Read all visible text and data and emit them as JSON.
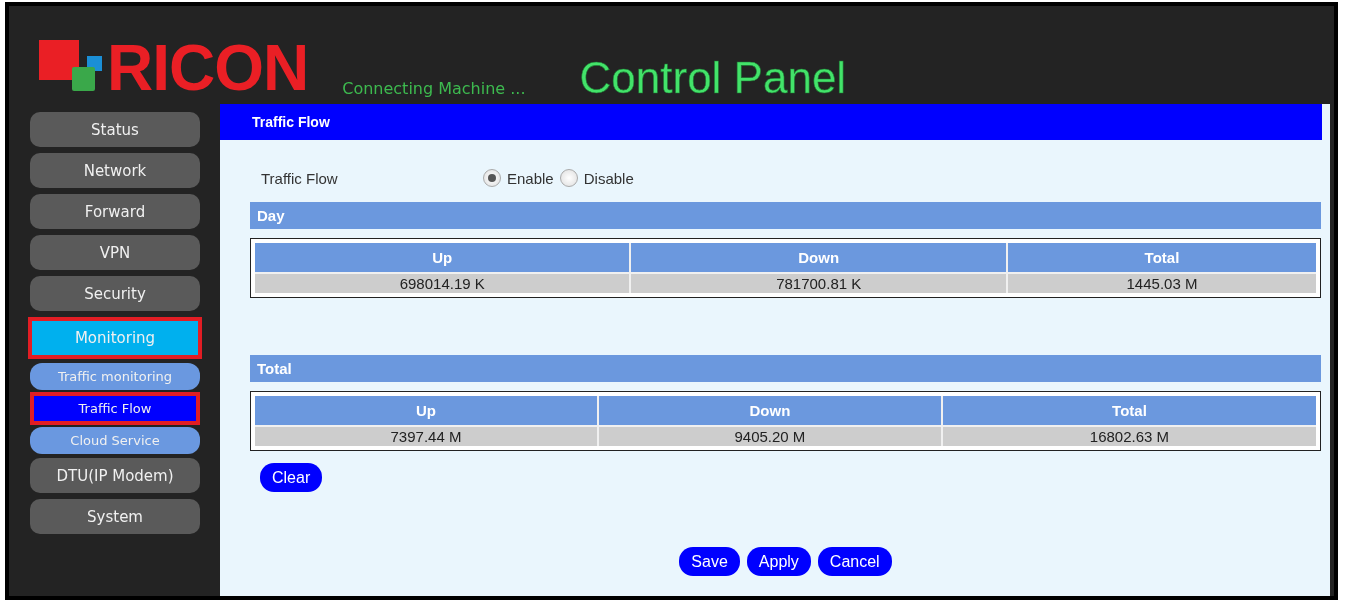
{
  "header": {
    "brand": "RICON",
    "tagline": "Connecting Machine ...",
    "title": "Control Panel"
  },
  "sidebar": {
    "items": [
      {
        "label": "Status",
        "kind": "main",
        "selected": false,
        "highlighted": false
      },
      {
        "label": "Network",
        "kind": "main",
        "selected": false,
        "highlighted": false
      },
      {
        "label": "Forward",
        "kind": "main",
        "selected": false,
        "highlighted": false
      },
      {
        "label": "VPN",
        "kind": "main",
        "selected": false,
        "highlighted": false
      },
      {
        "label": "Security",
        "kind": "main",
        "selected": false,
        "highlighted": false
      },
      {
        "label": "Monitoring",
        "kind": "main",
        "selected": true,
        "highlighted": true
      },
      {
        "label": "Traffic monitoring",
        "kind": "sub",
        "selected": false,
        "highlighted": false
      },
      {
        "label": "Traffic Flow",
        "kind": "sub",
        "selected": true,
        "highlighted": true
      },
      {
        "label": "Cloud Service",
        "kind": "sub",
        "selected": false,
        "highlighted": false
      },
      {
        "label": "DTU(IP Modem)",
        "kind": "main",
        "selected": false,
        "highlighted": false
      },
      {
        "label": "System",
        "kind": "main",
        "selected": false,
        "highlighted": false
      }
    ]
  },
  "panel": {
    "title": "Traffic Flow",
    "setting": {
      "label": "Traffic Flow",
      "options": [
        {
          "label": "Enable",
          "selected": true
        },
        {
          "label": "Disable",
          "selected": false
        }
      ]
    },
    "sections": [
      {
        "title": "Day",
        "columns": [
          "Up",
          "Down",
          "Total"
        ],
        "row": [
          "698014.19 K",
          "781700.81 K",
          "1445.03 M"
        ]
      },
      {
        "title": "Total",
        "columns": [
          "Up",
          "Down",
          "Total"
        ],
        "row": [
          "7397.44 M",
          "9405.20 M",
          "16802.63 M"
        ]
      }
    ],
    "clear_button": "Clear",
    "buttons": [
      "Save",
      "Apply",
      "Cancel"
    ]
  }
}
